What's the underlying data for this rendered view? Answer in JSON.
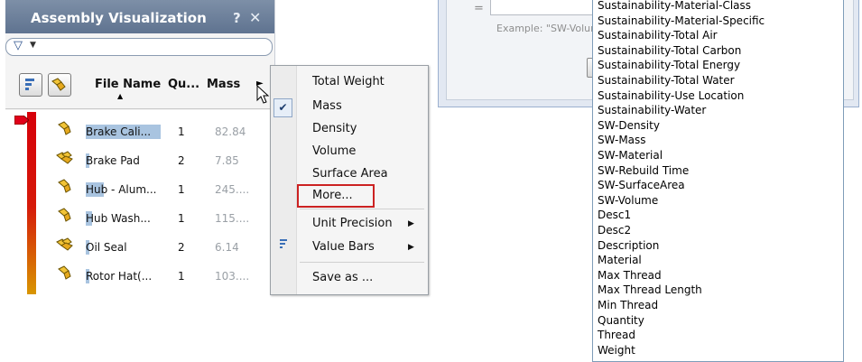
{
  "panel": {
    "title": "Assembly Visualization",
    "help_glyph": "?",
    "close_glyph": "✕",
    "filter_icon": "filter-icon",
    "columns": {
      "file_name": "File Name",
      "quantity": "Qu...",
      "mass": "Mass"
    },
    "rows": [
      {
        "name": "Brake Cali...",
        "qty": "1",
        "mass": "82.84",
        "icon": "single-part-icon",
        "bar": 0.92
      },
      {
        "name": "Brake Pad",
        "qty": "2",
        "mass": "7.85",
        "icon": "multi-part-icon",
        "bar": 0.0
      },
      {
        "name": "Hub - Alum...",
        "qty": "1",
        "mass": "245....",
        "icon": "single-part-icon",
        "bar": 0.22
      },
      {
        "name": "Hub Wash...",
        "qty": "1",
        "mass": "115....",
        "icon": "single-part-icon",
        "bar": 0.08
      },
      {
        "name": "Oil Seal",
        "qty": "2",
        "mass": "6.14",
        "icon": "multi-part-icon",
        "bar": 0.0
      },
      {
        "name": "Rotor Hat(...",
        "qty": "1",
        "mass": "103....",
        "icon": "single-part-icon",
        "bar": 0.0
      }
    ]
  },
  "menu": {
    "items": [
      {
        "label": "Total Weight",
        "checked": false
      },
      {
        "label": "Mass",
        "checked": true
      },
      {
        "label": "Density",
        "checked": false
      },
      {
        "label": "Volume",
        "checked": false
      },
      {
        "label": "Surface Area",
        "checked": false
      },
      {
        "label": "More...",
        "highlighted": true
      },
      {
        "label": "Unit Precision",
        "submenu": true
      },
      {
        "label": "Value Bars",
        "submenu": true
      },
      {
        "label": "Save as ..."
      }
    ],
    "highlight_color": "#cc2222"
  },
  "dialog": {
    "equals": "=",
    "example": "Example: \"SW-Volum"
  },
  "property_list": [
    "Sustainability-Material-Class",
    "Sustainability-Material-Specific",
    "Sustainability-Total Air",
    "Sustainability-Total Carbon",
    "Sustainability-Total Energy",
    "Sustainability-Total Water",
    "Sustainability-Use Location",
    "Sustainability-Water",
    "SW-Density",
    "SW-Mass",
    "SW-Material",
    "SW-Rebuild Time",
    "SW-SurfaceArea",
    "SW-Volume",
    "Desc1",
    "Desc2",
    "Description",
    "Material",
    "Max Thread",
    "Max Thread Length",
    "Min Thread",
    "Quantity",
    "Thread",
    "Weight"
  ],
  "colors": {
    "title_bar": "#6a7d98",
    "value_bar": "#a9c4e0",
    "list_border": "#7f9db9"
  }
}
